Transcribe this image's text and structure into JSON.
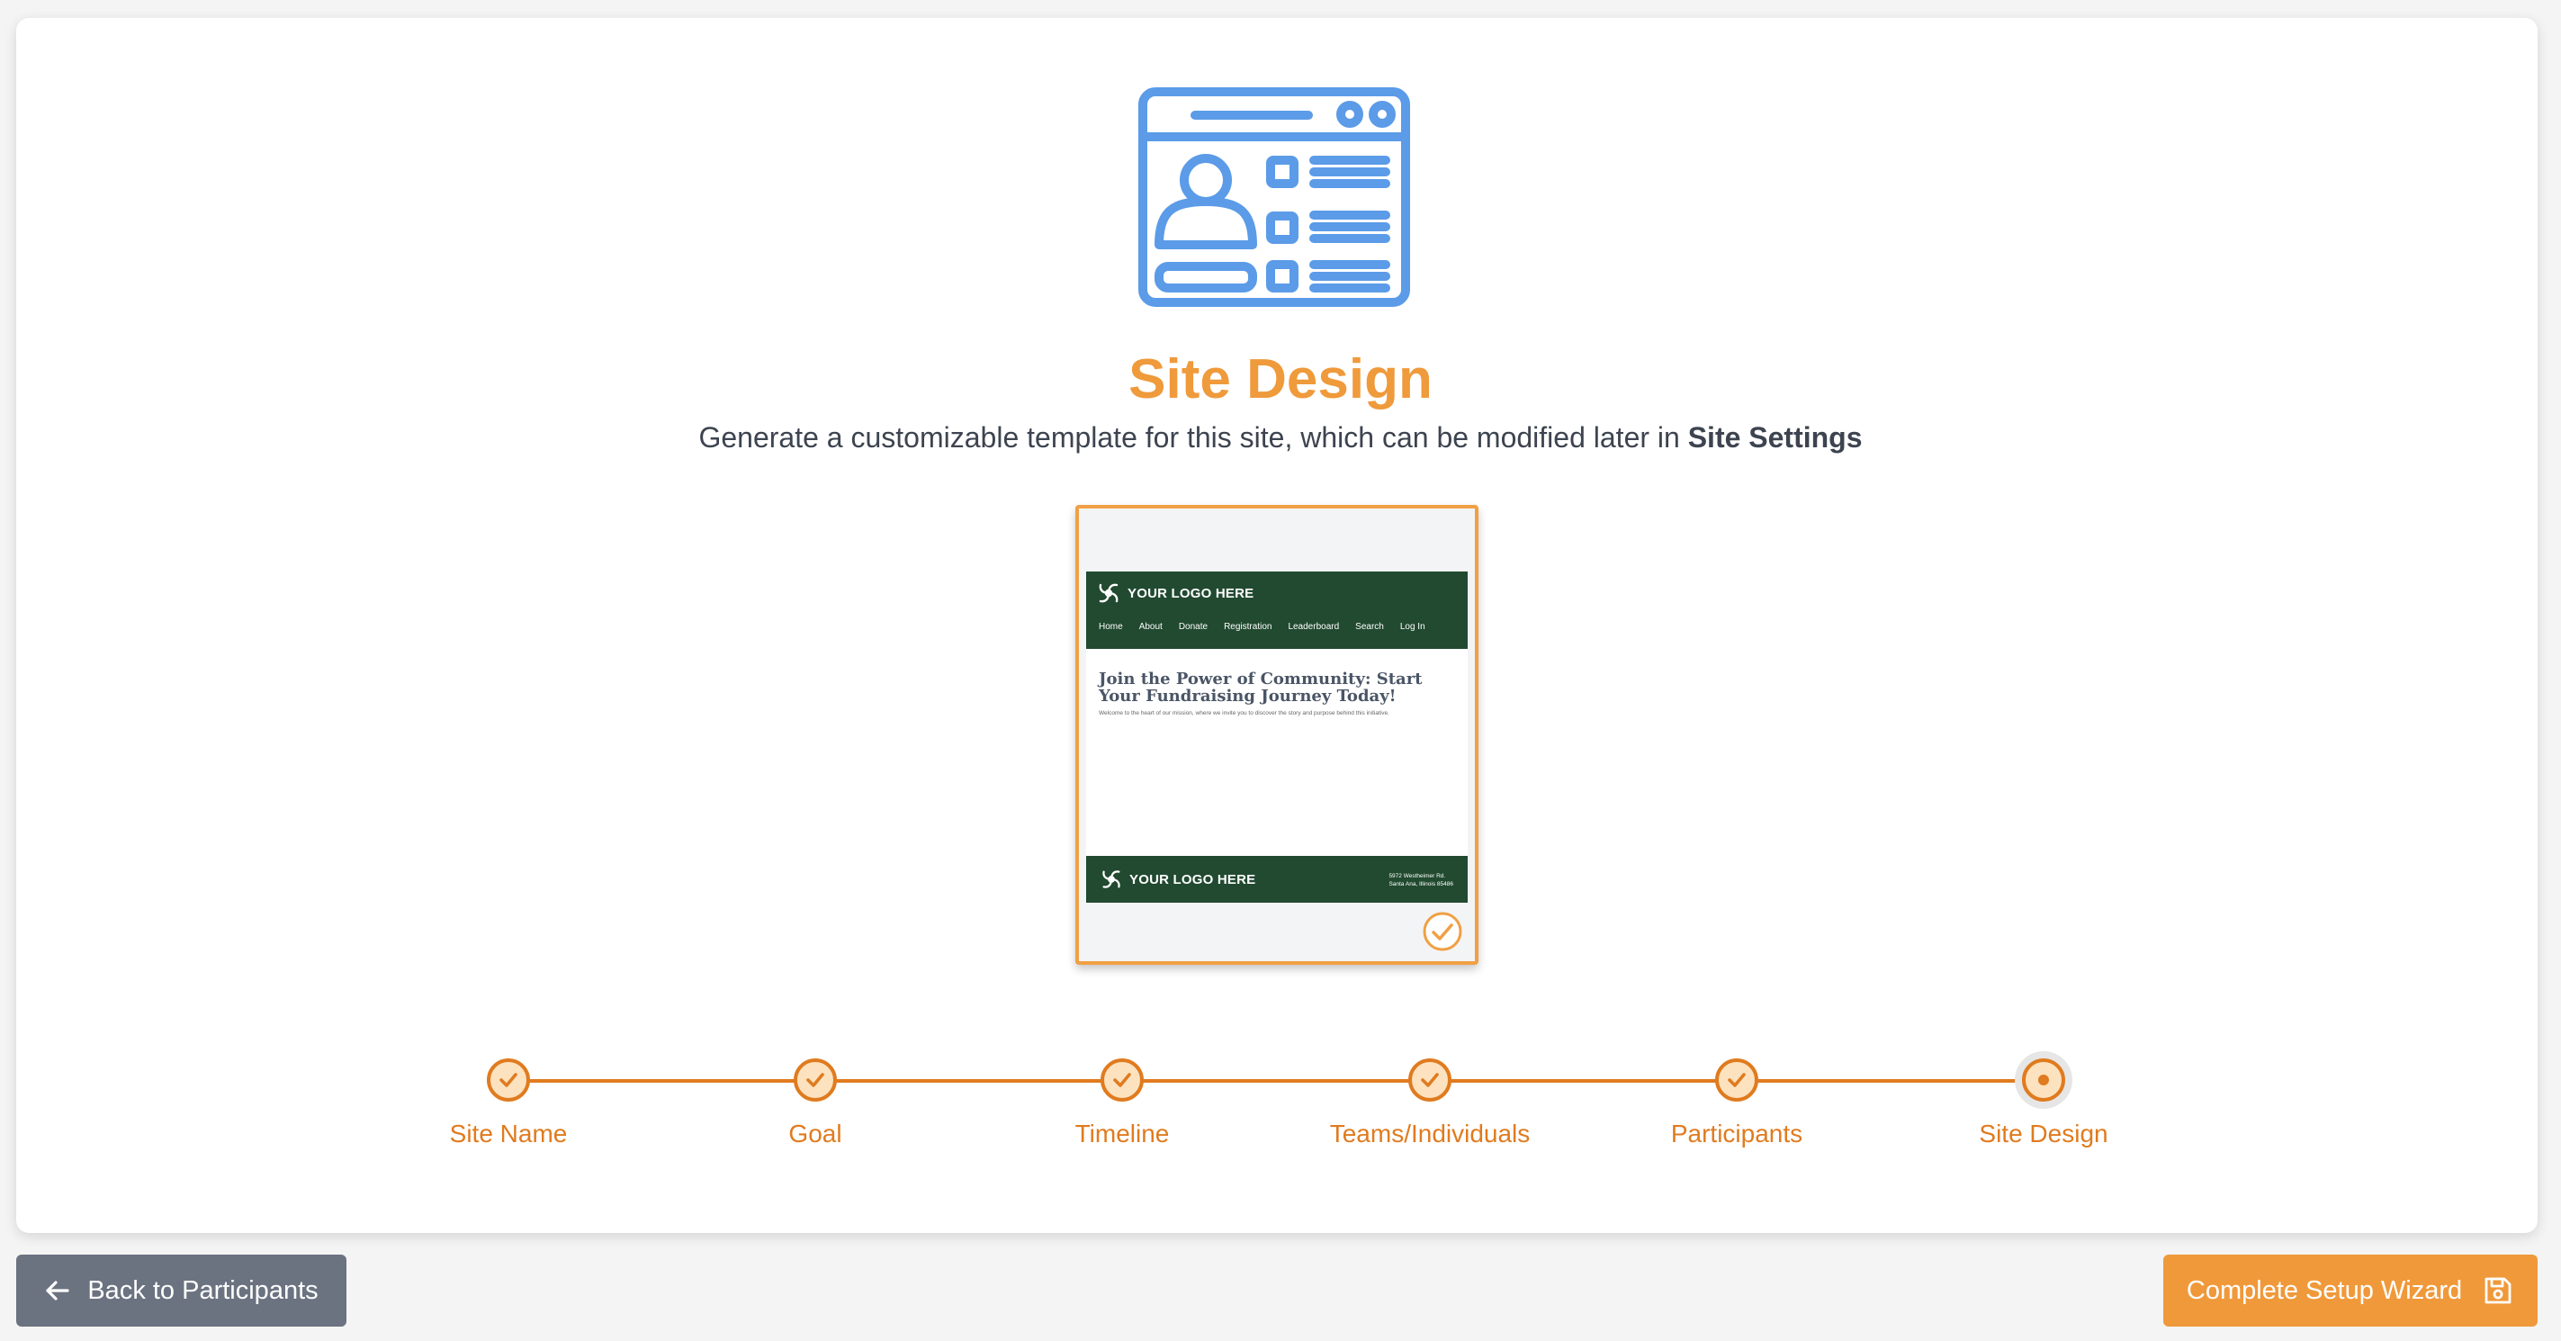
{
  "page": {
    "title": "Site Design",
    "subtitle_prefix": "Generate a customizable template for this site, which can be modified later in",
    "subtitle_emphasis": "Site Settings"
  },
  "hero_icon": "webpage-profile-icon",
  "template_preview": {
    "logo_text": "YOUR LOGO HERE",
    "nav": [
      "Home",
      "About",
      "Donate",
      "Registration",
      "Leaderboard",
      "Search",
      "Log In"
    ],
    "headline": "Join the Power of Community: Start Your Fundraising Journey Today!",
    "welcome_text": "Welcome to the heart of our mission, where we invite you to discover the story and purpose behind this initiative.",
    "footer_logo_text": "YOUR LOGO HERE",
    "address_line1": "5972 Westheimer Rd.",
    "address_line2": "Santa Ana, Illinois 85486",
    "selected": true
  },
  "steps": [
    {
      "label": "Site Name",
      "state": "complete"
    },
    {
      "label": "Goal",
      "state": "complete"
    },
    {
      "label": "Timeline",
      "state": "complete"
    },
    {
      "label": "Teams/Individuals",
      "state": "complete"
    },
    {
      "label": "Participants",
      "state": "complete"
    },
    {
      "label": "Site Design",
      "state": "current"
    }
  ],
  "buttons": {
    "back_label": "Back to Participants",
    "complete_label": "Complete Setup Wizard"
  },
  "colors": {
    "accent": "#ef9a3b",
    "step": "#e07b1f",
    "hero_icon": "#5b9be8",
    "template_green": "#214a30",
    "back_button": "#6b7280"
  }
}
